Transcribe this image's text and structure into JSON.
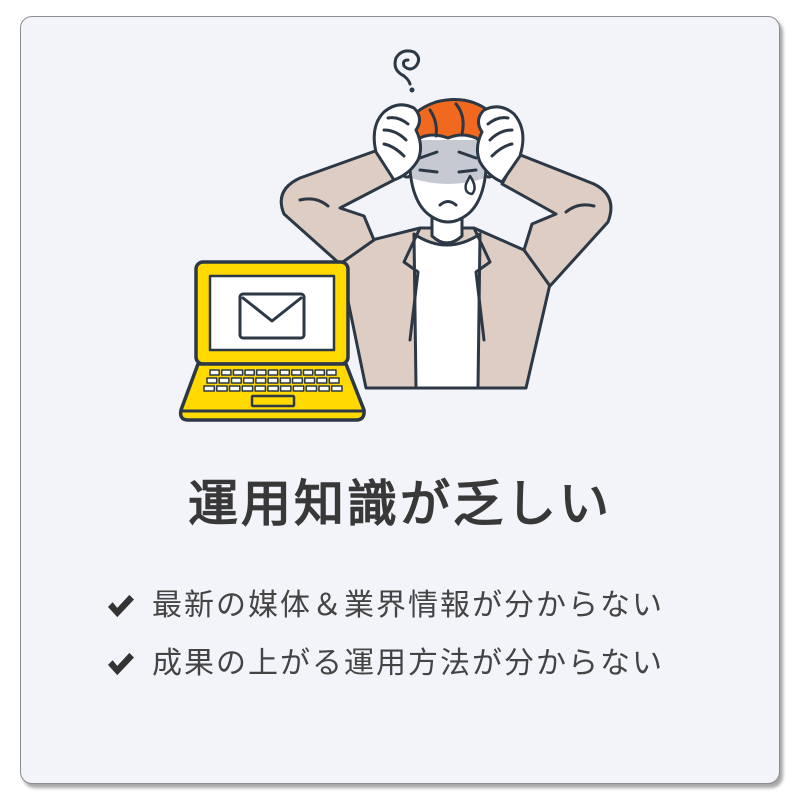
{
  "colors": {
    "card_background": "#f2f4fa",
    "card_border": "#8c8c8c",
    "accent_yellow": "#ffd900",
    "hair_orange": "#f0691f",
    "jacket_beige": "#ddcdc2",
    "face_shade": "#c6c9d1",
    "outline": "#2c3845",
    "title_text": "#383838",
    "body_text": "#444444"
  },
  "illustration": {
    "icons": {
      "swirl": "confused-swirl-icon",
      "sweat": "sweat-drop-icon",
      "laptop": "laptop-icon",
      "mail": "envelope-icon"
    }
  },
  "title": "運用知識が乏しい",
  "checklist": [
    {
      "icon": "check-icon",
      "text": "最新の媒体＆業界情報が分からない"
    },
    {
      "icon": "check-icon",
      "text": "成果の上がる運用方法が分からない"
    }
  ]
}
